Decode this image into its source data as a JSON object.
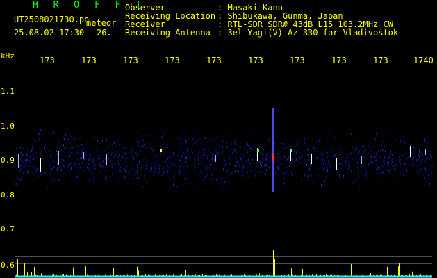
{
  "header": {
    "app_name": "H R O F F T",
    "file_name": "UT2508021730.pn",
    "tag": "meteor",
    "datetime": "25.08.02 17:30",
    "count": "26.",
    "fields": [
      {
        "label": "Observer",
        "value": ": Masaki Kano"
      },
      {
        "label": "Receiving Location",
        "value": ": Shibukawa, Gunma, Japan"
      },
      {
        "label": "Receiver",
        "value": ": RTL-SDR SDR# 43dB L15 103.2MHz CW"
      },
      {
        "label": "Receiving Antenna",
        "value": ": 3el Yagi(V) Az 330 for Vladivostok"
      }
    ]
  },
  "axes": {
    "unit": "kHz",
    "x_ticks": [
      "173",
      "173",
      "173",
      "173",
      "173",
      "173",
      "173",
      "173",
      "173",
      "1740"
    ],
    "y_ticks": [
      "1.1",
      "1.0",
      "0.9",
      "0.8",
      "0.7",
      "0.6"
    ]
  },
  "colors": {
    "header_text": "#ffff00",
    "app_name": "#00ff00",
    "noise": "#1010a0",
    "echo": "#ffffff",
    "bars": "#ffff00",
    "baseline": "#00ffff"
  }
}
